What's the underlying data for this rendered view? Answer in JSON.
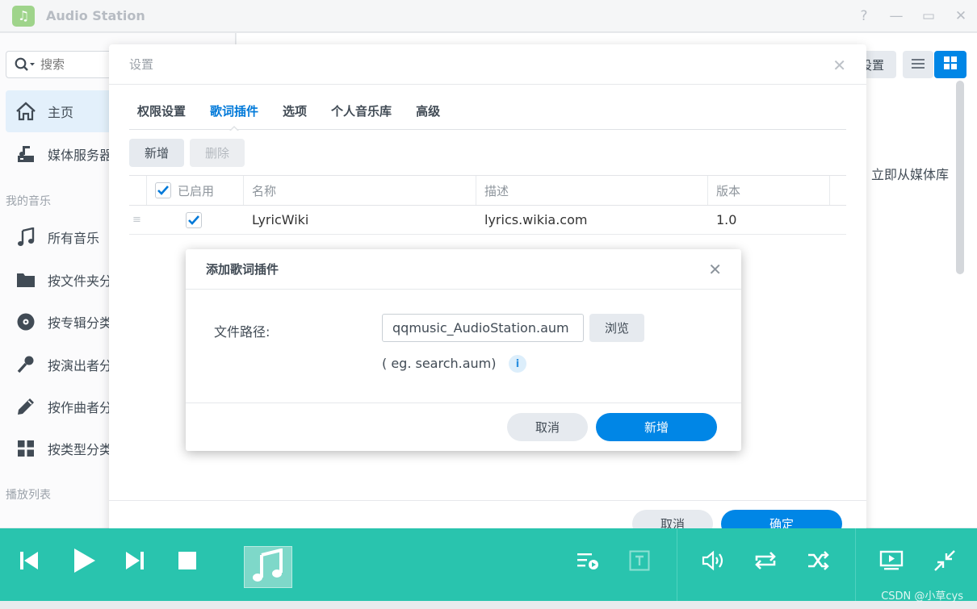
{
  "app": {
    "title": "Audio Station"
  },
  "window": {
    "help": "?",
    "minimize": "—",
    "maximize": "▭",
    "close": "✕"
  },
  "sidebar": {
    "search_placeholder": "搜索",
    "items": [
      {
        "label": "主页",
        "icon": "home-icon"
      },
      {
        "label": "媒体服务器",
        "icon": "media-server-icon"
      }
    ],
    "section_my_music": "我的音乐",
    "music_items": [
      {
        "label": "所有音乐",
        "icon": "music-note-icon"
      },
      {
        "label": "按文件夹分",
        "icon": "folder-icon"
      },
      {
        "label": "按专辑分类",
        "icon": "disc-icon"
      },
      {
        "label": "按演出者分",
        "icon": "microphone-icon"
      },
      {
        "label": "按作曲者分",
        "icon": "pen-icon"
      },
      {
        "label": "按类型分类",
        "icon": "grid-icon"
      }
    ],
    "section_playlist": "播放列表"
  },
  "background": {
    "settings_btn_partial": "设置",
    "text_partial": "立即从媒体库"
  },
  "settings": {
    "title": "设置",
    "tabs": [
      "权限设置",
      "歌词插件",
      "选项",
      "个人音乐库",
      "高级"
    ],
    "active_tab": 1,
    "add_label": "新增",
    "delete_label": "删除",
    "columns": {
      "enabled": "已启用",
      "name": "名称",
      "description": "描述",
      "version": "版本"
    },
    "rows": [
      {
        "name": "LyricWiki",
        "description": "lyrics.wikia.com",
        "version": "1.0",
        "enabled": true
      }
    ],
    "cancel_label": "取消",
    "ok_label": "确定"
  },
  "add_plugin": {
    "title": "添加歌词插件",
    "file_path_label": "文件路径:",
    "file_path_value": "qqmusic_AudioStation.aum",
    "browse_label": "浏览",
    "hint": "( eg. search.aum)",
    "cancel_label": "取消",
    "add_label": "新增"
  },
  "watermark": "CSDN @小草cys",
  "colors": {
    "accent": "#0086e6",
    "player": "#29c4ae",
    "active_tab": "#0079d9"
  }
}
